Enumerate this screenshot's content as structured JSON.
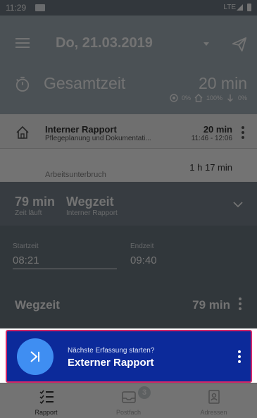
{
  "status_bar": {
    "time": "11:29",
    "network": "LTE"
  },
  "header": {
    "date": "Do, 21.03.2019"
  },
  "summary": {
    "label": "Gesamtzeit",
    "value": "20 min",
    "stat_1": "0%",
    "stat_2": "100%",
    "stat_3": "0%"
  },
  "entries": [
    {
      "title": "Interner Rapport",
      "subtitle": "Pflegeplanung und Dokumentati...",
      "duration": "20 min",
      "time_range": "11:46 - 12:06"
    },
    {
      "title": "Arbeitsunterbruch",
      "duration": "1 h 17 min"
    }
  ],
  "timer": {
    "minutes": "79 min",
    "status": "Zeit läuft",
    "title": "Wegzeit",
    "subtitle": "Interner Rapport"
  },
  "detail": {
    "start_label": "Startzeit",
    "start_value": "08:21",
    "end_label": "Endzeit",
    "end_value": "09:40",
    "type_label": "Wegzeit",
    "type_value": "79 min"
  },
  "next": {
    "hint": "Nächste Erfassung starten?",
    "title": "Externer Rapport"
  },
  "nav": {
    "rapport": "Rapport",
    "postfach": "Postfach",
    "postfach_badge": "3",
    "adressen": "Adressen"
  },
  "colors": {
    "header_bg": "#a6b3bd",
    "timer_bg": "#7a8690",
    "next_bar_bg": "#0c2a9a",
    "next_bar_border": "#d12769",
    "next_button": "#3f8ef2"
  }
}
